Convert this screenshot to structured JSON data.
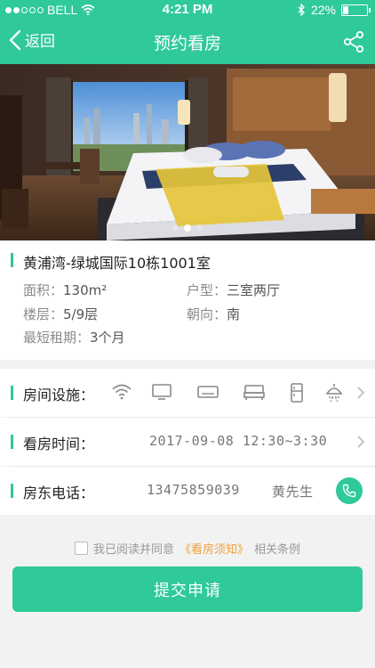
{
  "status_bar": {
    "carrier": "BELL",
    "time": "4:21 PM",
    "battery": "22%",
    "battery_level": 0.22
  },
  "navbar": {
    "back_label": "返回",
    "title": "预约看房",
    "share_icon": "share-icon"
  },
  "gallery": {
    "page_count": 3,
    "current_index": 1
  },
  "property": {
    "name": "黄浦湾-绿城国际10栋1001室",
    "area_label": "面积：",
    "area": "130m²",
    "layout_label": "户型：",
    "layout": "三室两厅",
    "floor_label": "楼层：",
    "floor": "5/9层",
    "orientation_label": "朝向：",
    "orientation": "南",
    "min_lease_label": "最短租期：",
    "min_lease": "3个月"
  },
  "facilities": {
    "label": "房间设施：",
    "icons": [
      "wifi-icon",
      "tv-icon",
      "air-conditioner-icon",
      "bed-icon",
      "fridge-icon",
      "shower-icon"
    ]
  },
  "viewing": {
    "label": "看房时间：",
    "value": "2017-09-08 12:30~3:30"
  },
  "landlord": {
    "label": "房东电话：",
    "phone": "13475859039",
    "name": "黄先生"
  },
  "agreement": {
    "prefix": "我已阅读并同意",
    "link": "《看房须知》",
    "suffix": "相关条例"
  },
  "submit_label": "提交申请",
  "colors": {
    "accent": "#2fc99a",
    "link": "#f0a040"
  }
}
